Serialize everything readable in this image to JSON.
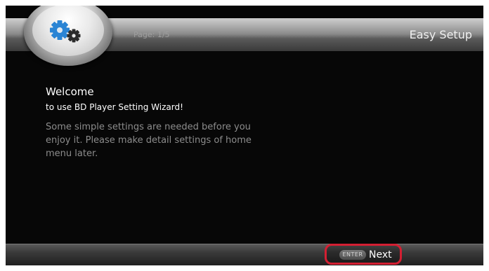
{
  "header": {
    "title": "Easy Setup",
    "page_indicator": "Page: 1/5",
    "icon": "gears-icon"
  },
  "content": {
    "welcome": "Welcome",
    "subtitle": "to use BD Player Setting Wizard!",
    "description": "Some simple settings are needed before you enjoy it. Please make detail settings of home menu later."
  },
  "footer": {
    "key_label": "ENTER",
    "next_label": "Next"
  },
  "colors": {
    "background": "#070707",
    "highlight": "#d41f32",
    "gear_blue": "#2a84d4"
  }
}
